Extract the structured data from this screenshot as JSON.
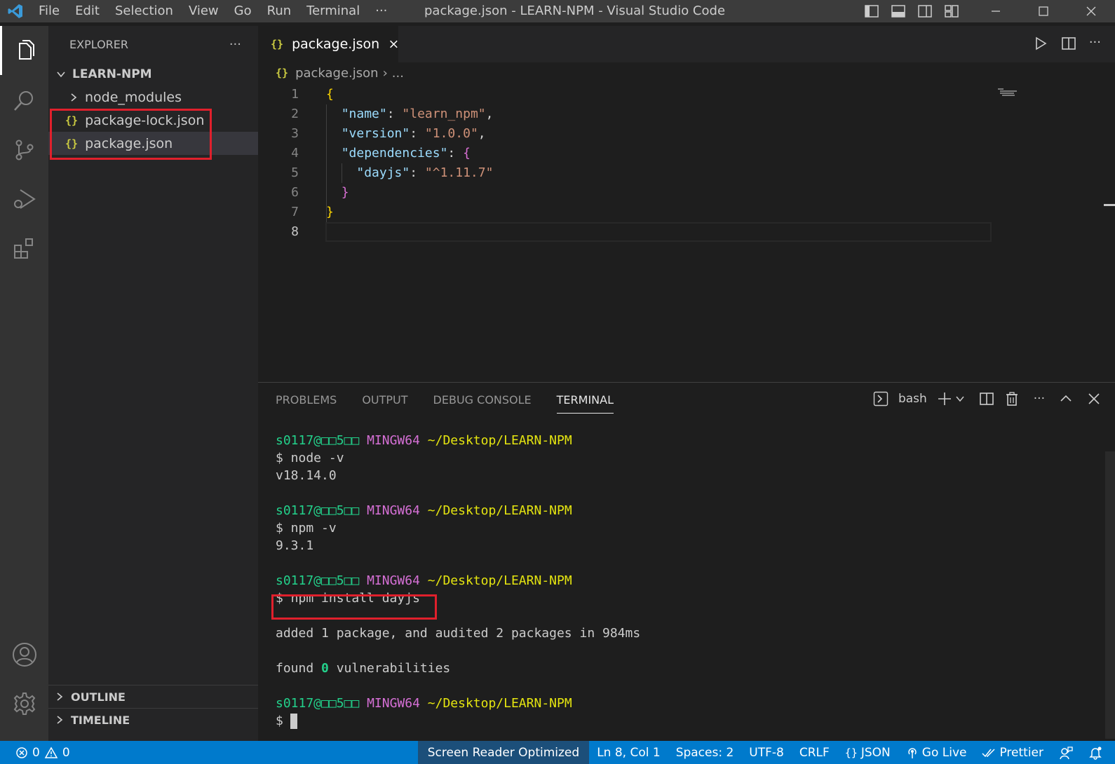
{
  "titlebar": {
    "menu": [
      "File",
      "Edit",
      "Selection",
      "View",
      "Go",
      "Run",
      "Terminal",
      "···"
    ],
    "window_title": "package.json - LEARN-NPM - Visual Studio Code"
  },
  "sidebar": {
    "header": "EXPLORER",
    "more": "···",
    "folder": "LEARN-NPM",
    "items": [
      {
        "label": "node_modules",
        "type": "folder"
      },
      {
        "label": "package-lock.json",
        "type": "json"
      },
      {
        "label": "package.json",
        "type": "json",
        "selected": true
      }
    ],
    "sections": [
      "OUTLINE",
      "TIMELINE"
    ]
  },
  "editor": {
    "tab_icon": "{}",
    "tab_label": "package.json",
    "breadcrumb_file": "package.json",
    "breadcrumb_more": "...",
    "lines": [
      "1",
      "2",
      "3",
      "4",
      "5",
      "6",
      "7",
      "8"
    ],
    "code": {
      "open_brace": "{",
      "name_key": "\"name\"",
      "name_val": "\"learn_npm\"",
      "version_key": "\"version\"",
      "version_val": "\"1.0.0\"",
      "deps_key": "\"dependencies\"",
      "dep_key": "\"dayjs\"",
      "dep_val": "\"^1.11.7\"",
      "close_inner": "}",
      "close_brace": "}"
    }
  },
  "panel": {
    "tabs": [
      "PROBLEMS",
      "OUTPUT",
      "DEBUG CONSOLE",
      "TERMINAL"
    ],
    "active_tab": "TERMINAL",
    "shell": "bash",
    "terminal": {
      "user": "s0117@□□5□□",
      "env": "MINGW64",
      "path": "~/Desktop/LEARN-NPM",
      "cmd1": "$ node -v",
      "out1": "v18.14.0",
      "cmd2": "$ npm -v",
      "out2": "9.3.1",
      "cmd3": "$ npm install dayjs",
      "out3": "added 1 package, and audited 2 packages in 984ms",
      "out4_pre": "found ",
      "out4_num": "0",
      "out4_post": " vulnerabilities",
      "prompt": "$"
    }
  },
  "statusbar": {
    "errors": "0",
    "warnings": "0",
    "screen_reader": "Screen Reader Optimized",
    "position": "Ln 8, Col 1",
    "spaces": "Spaces: 2",
    "encoding": "UTF-8",
    "eol": "CRLF",
    "language": "JSON",
    "go_live": "Go Live",
    "prettier": "Prettier"
  },
  "colors": {
    "accent": "#007acc",
    "highlight_box": "#e0202c"
  }
}
